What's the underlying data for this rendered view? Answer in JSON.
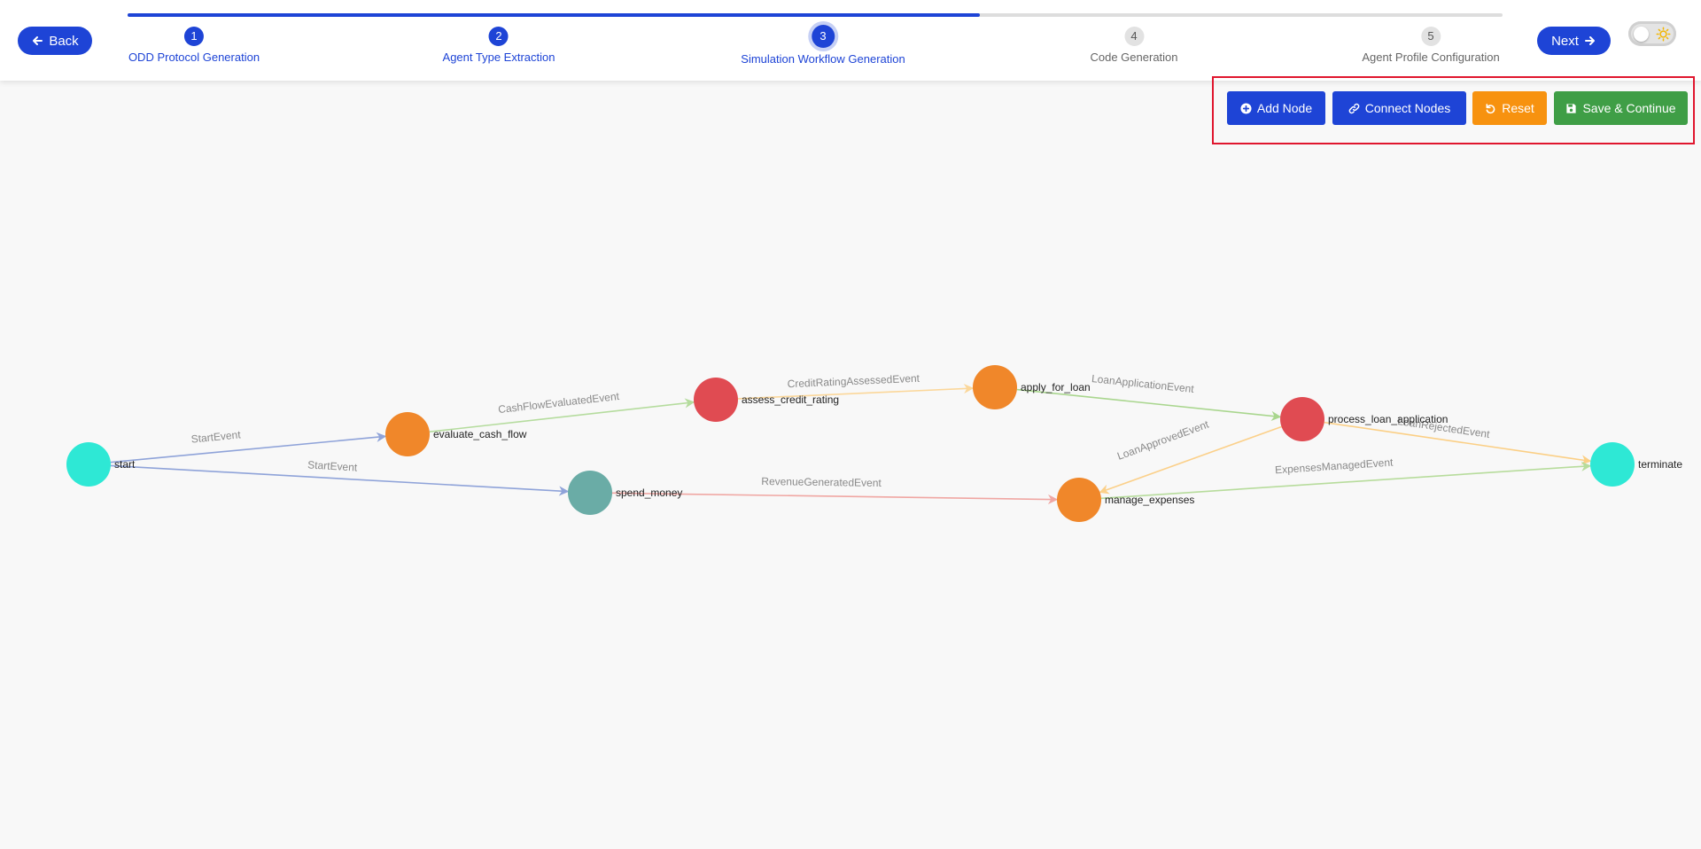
{
  "nav": {
    "back_label": "Back",
    "next_label": "Next"
  },
  "stepper": {
    "progress_fraction": 0.62,
    "steps": [
      {
        "number": "1",
        "label": "ODD Protocol Generation",
        "state": "done"
      },
      {
        "number": "2",
        "label": "Agent Type Extraction",
        "state": "done"
      },
      {
        "number": "3",
        "label": "Simulation Workflow Generation",
        "state": "current"
      },
      {
        "number": "4",
        "label": "Code Generation",
        "state": "todo"
      },
      {
        "number": "5",
        "label": "Agent Profile Configuration",
        "state": "todo"
      }
    ]
  },
  "theme_toggle": {
    "mode": "light",
    "icon": "sun-icon"
  },
  "toolbar": {
    "add_node_label": "Add Node",
    "connect_nodes_label": "Connect Nodes",
    "reset_label": "Reset",
    "save_continue_label": "Save & Continue"
  },
  "colors": {
    "primary": "#1e44d6",
    "warning": "#f7920f",
    "success": "#3f9e46",
    "highlight_border": "#e0162e",
    "node_start_end": "#2ee8d5",
    "node_orange": "#f0872a",
    "node_red": "#e04b52",
    "node_teal": "#6aaca6"
  },
  "workflow": {
    "nodes": [
      {
        "id": "start",
        "label": "start",
        "color": "#2ee8d5"
      },
      {
        "id": "evaluate_cash_flow",
        "label": "evaluate_cash_flow",
        "color": "#f0872a"
      },
      {
        "id": "spend_money",
        "label": "spend_money",
        "color": "#6aaca6"
      },
      {
        "id": "assess_credit_rating",
        "label": "assess_credit_rating",
        "color": "#e04b52"
      },
      {
        "id": "apply_for_loan",
        "label": "apply_for_loan",
        "color": "#f0872a"
      },
      {
        "id": "process_loan_application",
        "label": "process_loan_application",
        "color": "#e04b52"
      },
      {
        "id": "manage_expenses",
        "label": "manage_expenses",
        "color": "#f0872a"
      },
      {
        "id": "terminate",
        "label": "terminate",
        "color": "#2ee8d5"
      }
    ],
    "edges": [
      {
        "from": "start",
        "to": "evaluate_cash_flow",
        "label": "StartEvent",
        "color": "#8fa3d9"
      },
      {
        "from": "start",
        "to": "spend_money",
        "label": "StartEvent",
        "color": "#8fa3d9"
      },
      {
        "from": "evaluate_cash_flow",
        "to": "assess_credit_rating",
        "label": "CashFlowEvaluatedEvent",
        "color": "#b5dc9e"
      },
      {
        "from": "assess_credit_rating",
        "to": "apply_for_loan",
        "label": "CreditRatingAssessedEvent",
        "color": "#fbd79a"
      },
      {
        "from": "apply_for_loan",
        "to": "process_loan_application",
        "label": "LoanApplicationEvent",
        "color": "#a9d68e"
      },
      {
        "from": "process_loan_application",
        "to": "manage_expenses",
        "label": "LoanApprovedEvent",
        "color": "#fbd08a"
      },
      {
        "from": "process_loan_application",
        "to": "terminate",
        "label": "LoanRejectedEvent",
        "color": "#fbcf85"
      },
      {
        "from": "spend_money",
        "to": "manage_expenses",
        "label": "RevenueGeneratedEvent",
        "color": "#f0a7a3"
      },
      {
        "from": "manage_expenses",
        "to": "terminate",
        "label": "ExpensesManagedEvent",
        "color": "#b7dc9c"
      }
    ]
  }
}
